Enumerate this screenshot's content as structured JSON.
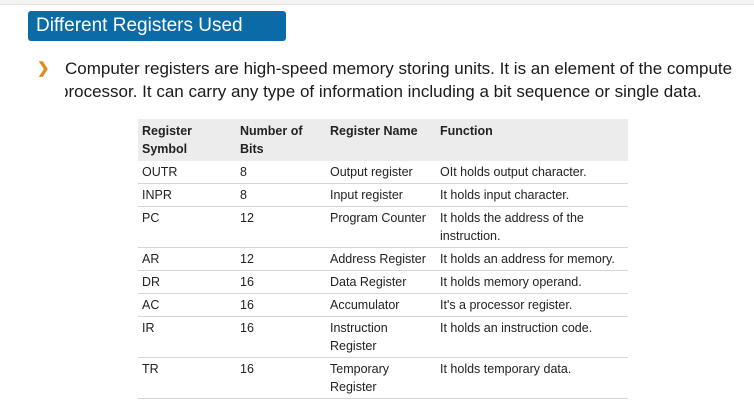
{
  "title": "Different Registers Used",
  "bullet_icon": "orange-chevron-bullet",
  "paragraph": {
    "line1": "Computer registers are high-speed memory storing units. It is an element of the compute",
    "line2": "processor. It can carry any type of information including a bit sequence or single data."
  },
  "table": {
    "headers": {
      "symbol_1": "Register",
      "symbol_2": "Symbol",
      "bits_1": "Number of",
      "bits_2": "Bits",
      "name": "Register Name",
      "function": "Function"
    },
    "rows": [
      {
        "symbol": "OUTR",
        "bits": "8",
        "name_1": "Output register",
        "name_2": "",
        "function_1": "OIt holds output character.",
        "function_2": ""
      },
      {
        "symbol": "INPR",
        "bits": "8",
        "name_1": "Input register",
        "name_2": "",
        "function_1": "It holds input character.",
        "function_2": ""
      },
      {
        "symbol": "PC",
        "bits": "12",
        "name_1": "Program Counter",
        "name_2": "",
        "function_1": "It holds the address of the",
        "function_2": "instruction."
      },
      {
        "symbol": "AR",
        "bits": "12",
        "name_1": "Address Register",
        "name_2": "",
        "function_1": "It holds an address for memory.",
        "function_2": ""
      },
      {
        "symbol": "DR",
        "bits": "16",
        "name_1": "Data Register",
        "name_2": "",
        "function_1": "It holds memory operand.",
        "function_2": ""
      },
      {
        "symbol": "AC",
        "bits": "16",
        "name_1": "Accumulator",
        "name_2": "",
        "function_1": "It's a processor register.",
        "function_2": ""
      },
      {
        "symbol": "IR",
        "bits": "16",
        "name_1": "Instruction",
        "name_2": "Register",
        "function_1": "It holds an instruction code.",
        "function_2": ""
      },
      {
        "symbol": "TR",
        "bits": "16",
        "name_1": "Temporary",
        "name_2": "Register",
        "function_1": "It holds temporary data.",
        "function_2": ""
      }
    ]
  }
}
